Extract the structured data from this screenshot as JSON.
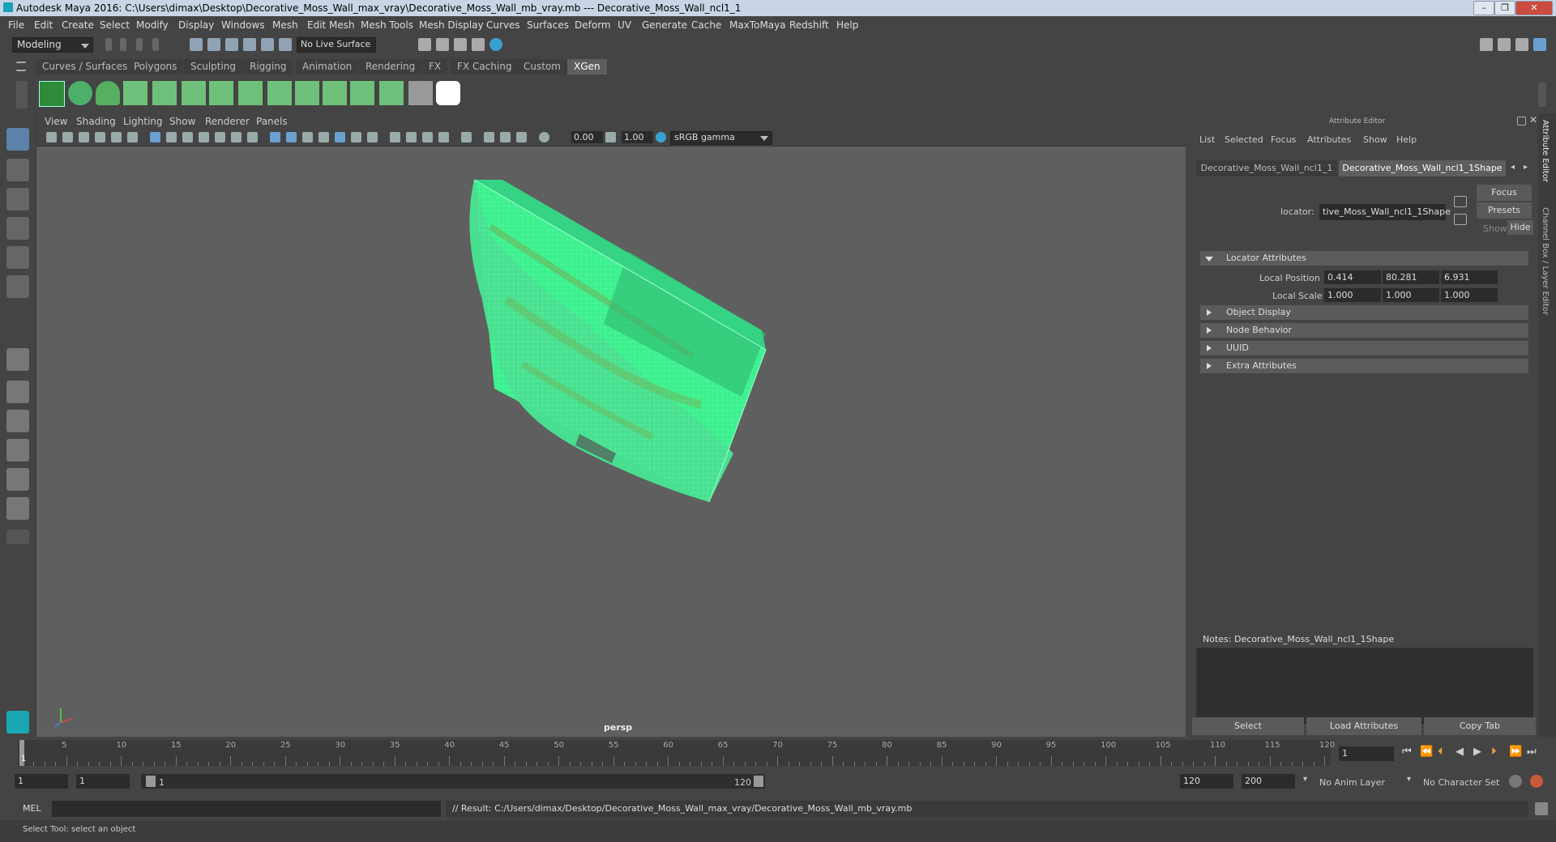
{
  "window": {
    "title": "Autodesk Maya 2016: C:\\Users\\dimax\\Desktop\\Decorative_Moss_Wall_max_vray\\Decorative_Moss_Wall_mb_vray.mb   ---   Decorative_Moss_Wall_ncl1_1",
    "controls": [
      "–",
      "❒",
      "✕"
    ]
  },
  "menubar": [
    "File",
    "Edit",
    "Create",
    "Select",
    "Modify",
    "Display",
    "Windows",
    "Mesh",
    "Edit Mesh",
    "Mesh Tools",
    "Mesh Display",
    "Curves",
    "Surfaces",
    "Deform",
    "UV",
    "Generate",
    "Cache",
    "MaxToMaya",
    "Redshift",
    "Help"
  ],
  "status": {
    "mode": "Modeling",
    "live_surface": "No Live Surface"
  },
  "shelf_tabs": [
    "Curves / Surfaces",
    "Polygons",
    "Sculpting",
    "Rigging",
    "Animation",
    "Rendering",
    "FX",
    "FX Caching",
    "Custom",
    "XGen"
  ],
  "viewport": {
    "menu": [
      "View",
      "Shading",
      "Lighting",
      "Show",
      "Renderer",
      "Panels"
    ],
    "exposure": "0.00",
    "gamma": "1.00",
    "colorspace": "sRGB gamma",
    "camera_label": "persp"
  },
  "attribute_editor": {
    "header": "Attribute Editor",
    "menu": [
      "List",
      "Selected",
      "Focus",
      "Attributes",
      "Show",
      "Help"
    ],
    "tabs": [
      "Decorative_Moss_Wall_ncl1_1",
      "Decorative_Moss_Wall_ncl1_1Shape"
    ],
    "node_label": "locator:",
    "node_value": "tive_Moss_Wall_ncl1_1Shape",
    "buttons": {
      "focus": "Focus",
      "presets": "Presets",
      "show": "Show",
      "hide": "Hide"
    },
    "sections": [
      "Locator Attributes",
      "Object Display",
      "Node Behavior",
      "UUID",
      "Extra Attributes"
    ],
    "local_position": {
      "label": "Local Position",
      "values": [
        "0.414",
        "80.281",
        "6.931"
      ]
    },
    "local_scale": {
      "label": "Local Scale",
      "values": [
        "1.000",
        "1.000",
        "1.000"
      ]
    },
    "notes_label": "Notes:  Decorative_Moss_Wall_ncl1_1Shape",
    "bottom_buttons": [
      "Select",
      "Load Attributes",
      "Copy Tab"
    ]
  },
  "side_tabs": [
    "Attribute Editor",
    "Channel Box / Layer Editor"
  ],
  "timeline": {
    "labels": [
      "5",
      "10",
      "15",
      "20",
      "25",
      "30",
      "35",
      "40",
      "45",
      "50",
      "55",
      "60",
      "65",
      "70",
      "75",
      "80",
      "85",
      "90",
      "95",
      "100",
      "105",
      "110",
      "115",
      "120"
    ],
    "start_marker": "1",
    "current_frame": "1"
  },
  "range": {
    "start": "1",
    "playback_start": "1",
    "slider_start": "1",
    "slider_end": "120",
    "playback_end": "120",
    "end": "200",
    "anim_layer": "No Anim Layer",
    "character_set": "No Character Set"
  },
  "command": {
    "lang": "MEL",
    "result": "// Result: C:/Users/dimax/Desktop/Decorative_Moss_Wall_max_vray/Decorative_Moss_Wall_mb_vray.mb"
  },
  "help_line": "Select Tool: select an object",
  "colors": {
    "wire": "#3cf08e",
    "active_tab": "#5e5e5e",
    "bg": "#444444",
    "viewport": "#5f5f5f"
  }
}
